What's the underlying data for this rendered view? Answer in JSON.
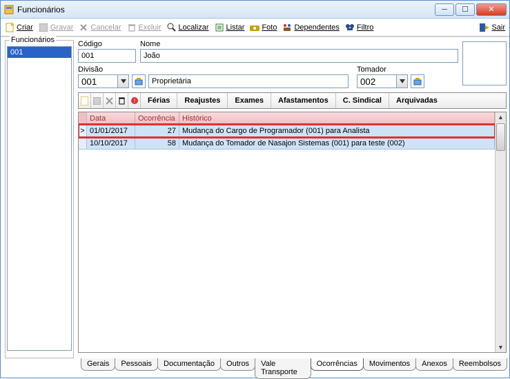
{
  "titlebar": {
    "title": "Funcionários"
  },
  "toolbar": {
    "criar": "Criar",
    "gravar": "Gravar",
    "cancelar": "Cancelar",
    "excluir": "Excluir",
    "localizar": "Localizar",
    "listar": "Listar",
    "foto": "Foto",
    "dependentes": "Dependentes",
    "filtro": "Filtro",
    "sair": "Sair"
  },
  "sidebar": {
    "legend": "Funcionários",
    "items": [
      "001"
    ]
  },
  "form": {
    "codigo_label": "Código",
    "codigo_value": "001",
    "nome_label": "Nome",
    "nome_value": "João",
    "divisao_label": "Divisão",
    "divisao_value": "001",
    "divisao_desc": "Proprietária",
    "tomador_label": "Tomador",
    "tomador_value": "002"
  },
  "tabbar": {
    "ferias": "Férias",
    "reajustes": "Reajustes",
    "exames": "Exames",
    "afastamentos": "Afastamentos",
    "csindical": "C. Sindical",
    "arquivadas": "Arquivadas"
  },
  "grid": {
    "headers": {
      "data": "Data",
      "ocorrencia": "Ocorrência",
      "historico": "Histórico"
    },
    "rows": [
      {
        "data": "01/01/2017",
        "ocorrencia": "27",
        "historico": "Mudança do Cargo de Programador (001) para Analista",
        "selected": true,
        "cursor": ">"
      },
      {
        "data": "10/10/2017",
        "ocorrencia": "58",
        "historico": "Mudança do Tomador de Nasajon Sistemas (001) para teste (002)",
        "selected": false,
        "cursor": ""
      }
    ]
  },
  "bottom_tabs": [
    "Gerais",
    "Pessoais",
    "Documentação",
    "Outros",
    "Vale Transporte",
    "Ocorrências",
    "Movimentos",
    "Anexos",
    "Reembolsos"
  ],
  "active_bottom_tab": "Ocorrências"
}
